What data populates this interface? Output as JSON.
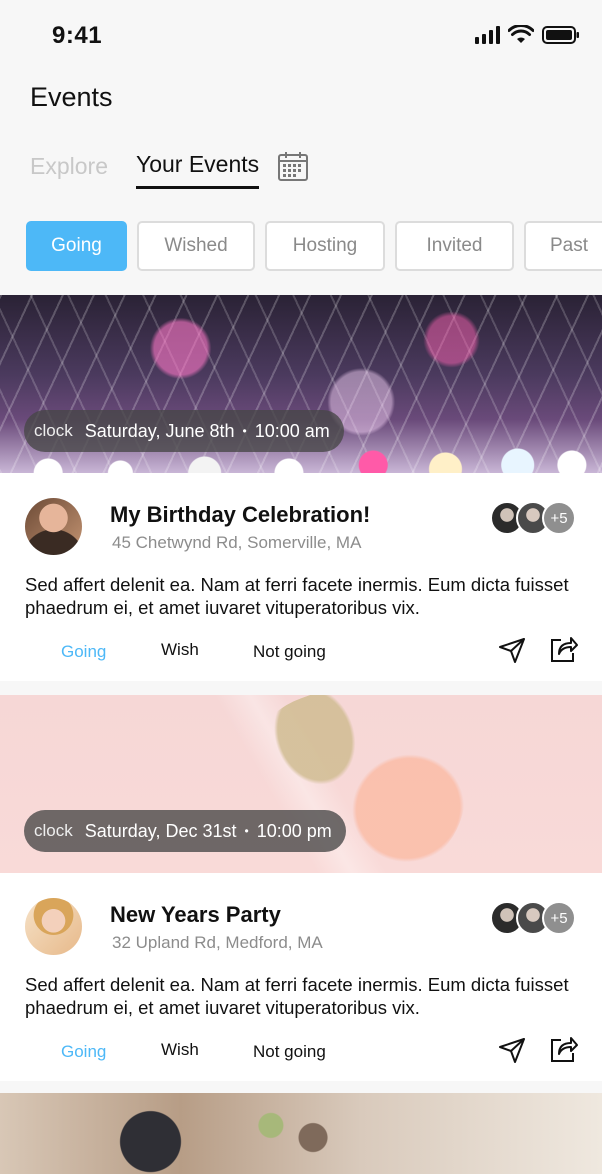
{
  "status_bar": {
    "time": "9:41"
  },
  "header": {
    "title": "Events"
  },
  "tabs": [
    {
      "label": "Explore",
      "active": false
    },
    {
      "label": "Your Events",
      "active": true
    }
  ],
  "filters": [
    {
      "label": "Going",
      "active": true
    },
    {
      "label": "Wished",
      "active": false
    },
    {
      "label": "Hosting",
      "active": false
    },
    {
      "label": "Invited",
      "active": false
    },
    {
      "label": "Past",
      "active": false
    }
  ],
  "events": [
    {
      "clock_label": "clock",
      "date": "Saturday, June 8th",
      "separator": "•",
      "time": "10:00 am",
      "title": "My Birthday Celebration!",
      "address": "45 Chetwynd Rd, Somerville, MA",
      "more_attendees": "+5",
      "description": "Sed affert delenit ea. Nam at ferri facete inermis. Eum dicta fuisset phaedrum ei, et amet iuvaret vituperatoribus vix.",
      "actions": {
        "going": "Going",
        "wish": "Wish",
        "not_going": "Not going"
      }
    },
    {
      "clock_label": "clock",
      "date": "Saturday, Dec 31st",
      "separator": "•",
      "time": "10:00 pm",
      "title": "New Years Party",
      "address": "32 Upland Rd, Medford, MA",
      "more_attendees": "+5",
      "description": "Sed affert delenit ea. Nam at ferri facete inermis. Eum dicta fuisset phaedrum ei, et amet iuvaret vituperatoribus vix.",
      "actions": {
        "going": "Going",
        "wish": "Wish",
        "not_going": "Not going"
      }
    }
  ],
  "colors": {
    "accent": "#4db8f7",
    "muted": "#8c8c8c"
  },
  "icons": [
    "signal-icon",
    "wifi-icon",
    "battery-icon",
    "calendar-icon",
    "send-icon",
    "share-icon"
  ]
}
